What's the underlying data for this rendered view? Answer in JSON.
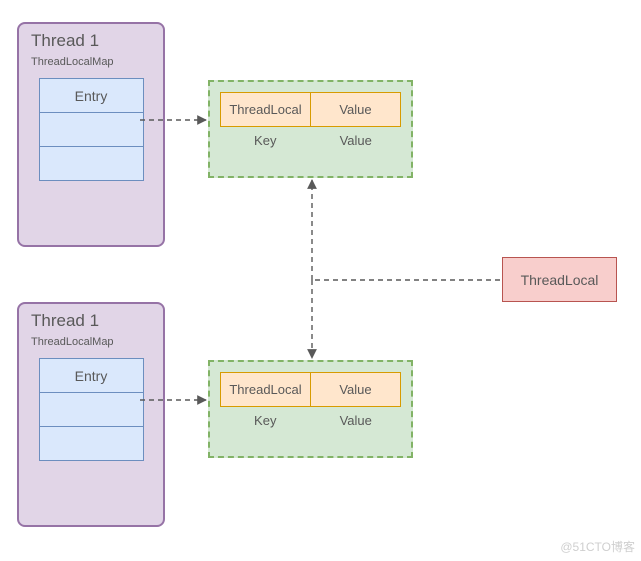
{
  "thread1": {
    "title": "Thread 1",
    "subtitle": "ThreadLocalMap",
    "entry_label": "Entry"
  },
  "thread2": {
    "title": "Thread 1",
    "subtitle": "ThreadLocalMap",
    "entry_label": "Entry"
  },
  "map1": {
    "key_cell": "ThreadLocal",
    "value_cell": "Value",
    "key_label": "Key",
    "value_label": "Value"
  },
  "map2": {
    "key_cell": "ThreadLocal",
    "value_cell": "Value",
    "key_label": "Key",
    "value_label": "Value"
  },
  "threadlocal_box": {
    "label": "ThreadLocal"
  },
  "watermark": "@51CTO博客",
  "colors": {
    "purple_fill": "#e1d5e7",
    "purple_border": "#9673a6",
    "blue_fill": "#dae8fc",
    "blue_border": "#6c8ebf",
    "green_fill": "#d5e8d4",
    "green_border": "#82b366",
    "orange_fill": "#ffe6cc",
    "orange_border": "#d79b00",
    "red_fill": "#f8cecc",
    "red_border": "#b85450"
  }
}
